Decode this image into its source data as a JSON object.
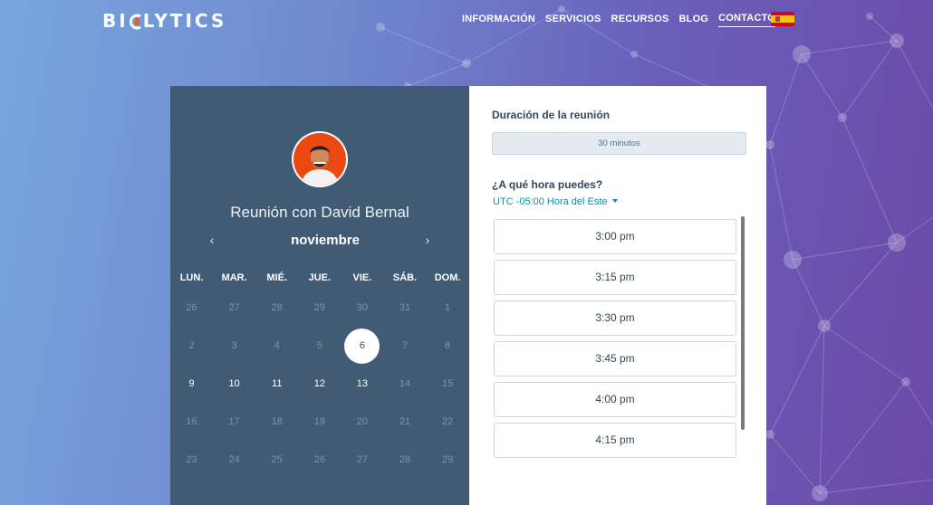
{
  "header": {
    "logo_text_before": "BI",
    "logo_text_after": "LYTICS",
    "nav": [
      {
        "label": "INFORMACIÓN"
      },
      {
        "label": "SERVICIOS"
      },
      {
        "label": "RECURSOS"
      },
      {
        "label": "BLOG"
      },
      {
        "label": "CONTACTO",
        "active": true
      }
    ],
    "language_flag": "spain-flag-icon"
  },
  "calendar": {
    "host_title": "Reunión con David Bernal",
    "month": "noviembre",
    "prev_icon": "‹",
    "next_icon": "›",
    "weekdays": [
      "LUN.",
      "MAR.",
      "MIÉ.",
      "JUE.",
      "VIE.",
      "SÁB.",
      "DOM."
    ],
    "weeks": [
      [
        "26",
        "27",
        "28",
        "29",
        "30",
        "31",
        "1"
      ],
      [
        "2",
        "3",
        "4",
        "5",
        "6",
        "7",
        "8"
      ],
      [
        "9",
        "10",
        "11",
        "12",
        "13",
        "14",
        "15"
      ],
      [
        "16",
        "17",
        "18",
        "19",
        "20",
        "21",
        "22"
      ],
      [
        "23",
        "24",
        "25",
        "26",
        "27",
        "28",
        "29"
      ]
    ],
    "selected_day": "6",
    "available_days": [
      "9",
      "10",
      "11",
      "12",
      "13"
    ]
  },
  "booking": {
    "duration_label": "Duración de la reunión",
    "duration_value": "30 minutos",
    "time_question": "¿A qué hora puedes?",
    "timezone": "UTC -05:00 Hora del Este",
    "slots": [
      "3:00 pm",
      "3:15 pm",
      "3:30 pm",
      "3:45 pm",
      "4:00 pm",
      "4:15 pm"
    ]
  },
  "colors": {
    "calendar_panel": "#425b74",
    "accent_link": "#0091ae",
    "logo_mark": "#f05a28"
  }
}
